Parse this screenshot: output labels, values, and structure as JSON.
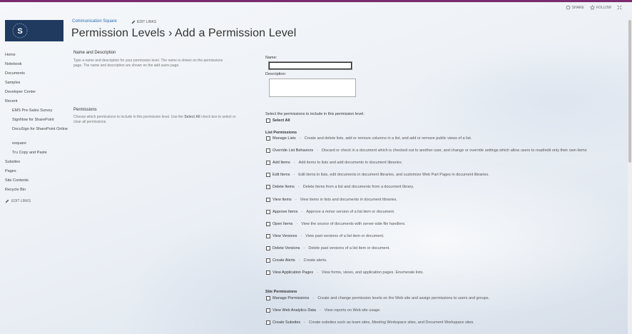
{
  "suite": {
    "share": "SHARE",
    "follow": "FOLLOW"
  },
  "logo": {
    "letter": "S"
  },
  "site": {
    "title": "Communication Square",
    "edit_links": "EDIT LINKS"
  },
  "page": {
    "title": "Permission Levels › Add a Permission Level"
  },
  "left_nav": {
    "items": [
      "Home",
      "Notebook",
      "Documents",
      "Samples",
      "Developer Center",
      "Recent"
    ],
    "recent": [
      "EMS Pre-Sales Survey",
      "SignNow for SharePoint",
      "DocuSign for SharePoint Online",
      "esquare",
      "Tru Copy and Paste"
    ],
    "after": [
      "Subsites",
      "Pages",
      "Site Contents",
      "Recycle Bin"
    ],
    "edit_links": "EDIT LINKS"
  },
  "name_section": {
    "heading": "Name and Description",
    "desc": "Type a name and description for your permission level. The name is shown on the permissions page. The name and description are shown on the add users page."
  },
  "permissions_section": {
    "heading": "Permissions",
    "desc_pre": "Choose which permissions to include in this permission level. Use the ",
    "desc_bold": "Select All",
    "desc_post": " check box to select or clear all permissions."
  },
  "form": {
    "name_label": "Name:",
    "name_value": "",
    "desc_label": "Description:",
    "desc_value": "",
    "perm_intro": "Select the permissions to include in this permission level.",
    "select_all": "Select All"
  },
  "list_permissions": {
    "heading": "List Permissions",
    "items": [
      {
        "name": "Manage Lists",
        "desc": "Create and delete lists, add or remove columns in a list, and add or remove public views of a list."
      },
      {
        "name": "Override List Behaviors",
        "desc": "Discard or check in a document which is checked out to another user, and change or override settings which allow users to read/edit only their own items"
      },
      {
        "name": "Add Items",
        "desc": "Add items to lists and add documents to document libraries."
      },
      {
        "name": "Edit Items",
        "desc": "Edit items in lists, edit documents in document libraries, and customize Web Part Pages in document libraries."
      },
      {
        "name": "Delete Items",
        "desc": "Delete items from a list and documents from a document library."
      },
      {
        "name": "View Items",
        "desc": "View items in lists and documents in document libraries."
      },
      {
        "name": "Approve Items",
        "desc": "Approve a minor version of a list item or document."
      },
      {
        "name": "Open Items",
        "desc": "View the source of documents with server-side file handlers."
      },
      {
        "name": "View Versions",
        "desc": "View past versions of a list item or document."
      },
      {
        "name": "Delete Versions",
        "desc": "Delete past versions of a list item or document."
      },
      {
        "name": "Create Alerts",
        "desc": "Create alerts."
      },
      {
        "name": "View Application Pages",
        "desc": "View forms, views, and application pages. Enumerate lists."
      }
    ]
  },
  "site_permissions": {
    "heading": "Site Permissions",
    "items": [
      {
        "name": "Manage Permissions",
        "desc": "Create and change permission levels on the Web site and assign permissions to users and groups."
      },
      {
        "name": "View Web Analytics Data",
        "desc": "View reports on Web site usage."
      },
      {
        "name": "Create Subsites",
        "desc": "Create subsites such as team sites, Meeting Workspace sites, and Document Workspace sites."
      }
    ]
  },
  "colors": {
    "accent": "#7b2b6e",
    "logo_bg": "#1f3a5e",
    "link": "#2a6bb0"
  }
}
